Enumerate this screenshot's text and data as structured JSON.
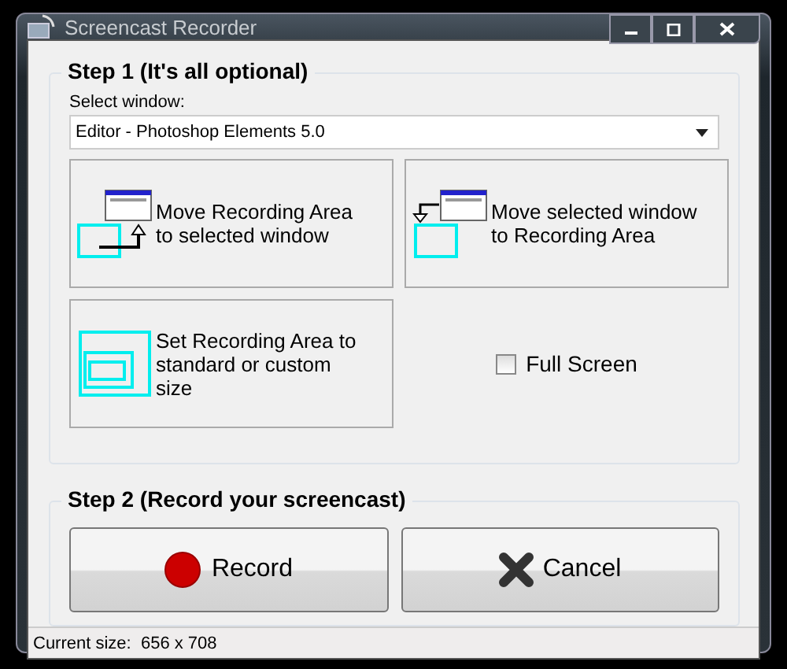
{
  "window": {
    "title": "Screencast Recorder"
  },
  "step1": {
    "title": "Step 1 (It's all optional)",
    "select_label": "Select window:",
    "select_value": "Editor - Photoshop Elements 5.0",
    "actions": [
      {
        "kind": "move-area",
        "label": "Move Recording Area to selected window"
      },
      {
        "kind": "move-window",
        "label": "Move selected window to Recording Area"
      },
      {
        "kind": "set-size",
        "label": "Set Recording Area to standard or custom size"
      }
    ],
    "full_screen": {
      "label": "Full Screen",
      "checked": false
    }
  },
  "step2": {
    "title": "Step 2 (Record your screencast)",
    "buttons": [
      {
        "kind": "record",
        "label": "Record"
      },
      {
        "kind": "cancel",
        "label": "Cancel"
      }
    ]
  },
  "status_bar": {
    "text": "Current size:  656 x 708"
  }
}
